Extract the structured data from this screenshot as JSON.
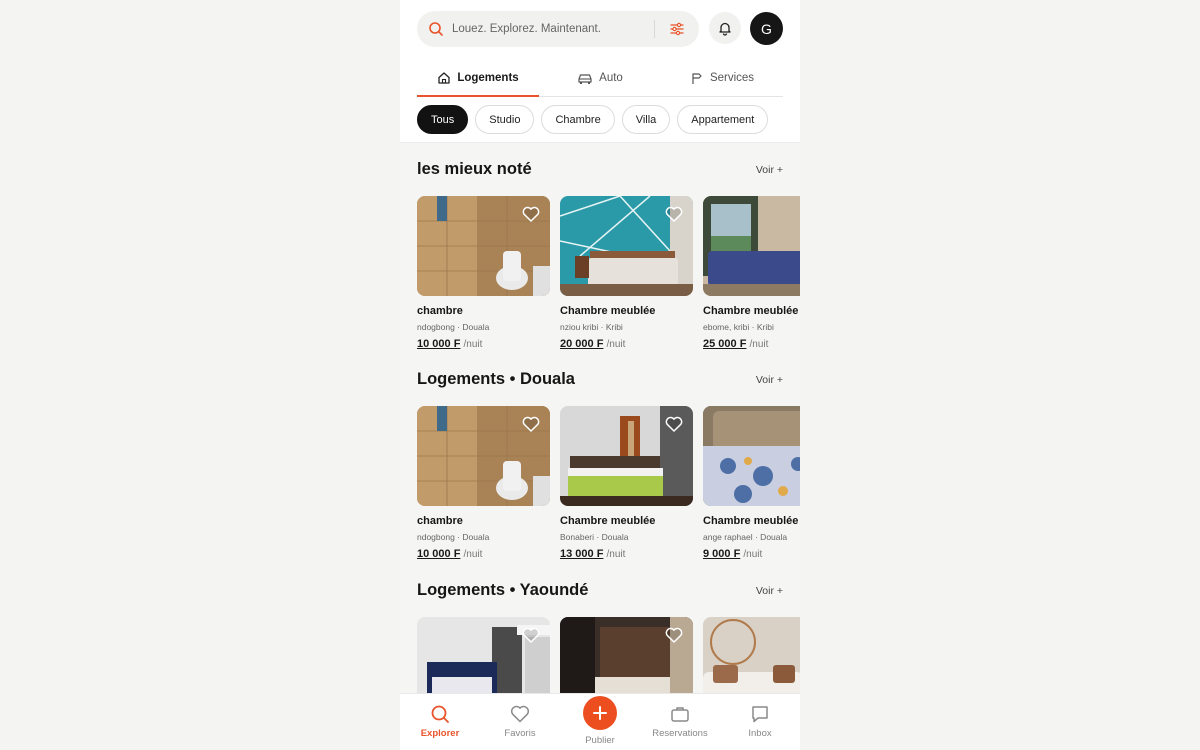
{
  "search": {
    "placeholder": "Louez. Explorez. Maintenant."
  },
  "avatar": {
    "initial": "G"
  },
  "tabs": [
    {
      "label": "Logements",
      "icon": "home-icon",
      "active": true
    },
    {
      "label": "Auto",
      "icon": "car-icon",
      "active": false
    },
    {
      "label": "Services",
      "icon": "services-icon",
      "active": false
    }
  ],
  "chips": [
    {
      "label": "Tous",
      "active": true
    },
    {
      "label": "Studio",
      "active": false
    },
    {
      "label": "Chambre",
      "active": false
    },
    {
      "label": "Villa",
      "active": false
    },
    {
      "label": "Appartement",
      "active": false
    }
  ],
  "sections": [
    {
      "title": "les mieux noté",
      "more": "Voir +",
      "cards": [
        {
          "title": "chambre",
          "location": "ndogbong · Douala",
          "price": "10 000 F",
          "unit": "/nuit",
          "image": "bathroom-photo"
        },
        {
          "title": "Chambre meublée",
          "location": "nziou kribi · Kribi",
          "price": "20 000 F",
          "unit": "/nuit",
          "image": "bedroom-teal-photo"
        },
        {
          "title": "Chambre meublée",
          "location": "ebome, kribi · Kribi",
          "price": "25 000 F",
          "unit": "/nuit",
          "image": "bedroom-window-photo"
        }
      ]
    },
    {
      "title": "Logements • Douala",
      "more": "Voir +",
      "cards": [
        {
          "title": "chambre",
          "location": "ndogbong · Douala",
          "price": "10 000 F",
          "unit": "/nuit",
          "image": "bathroom-photo"
        },
        {
          "title": "Chambre meublée",
          "location": "Bonaberi · Douala",
          "price": "13 000 F",
          "unit": "/nuit",
          "image": "bedroom-green-photo"
        },
        {
          "title": "Chambre meublée",
          "location": "ange raphael · Douala",
          "price": "9 000 F",
          "unit": "/nuit",
          "image": "bedroom-floral-photo"
        }
      ]
    },
    {
      "title": "Logements • Yaoundé",
      "more": "Voir +",
      "cards": [
        {
          "image": "bedroom-blue-photo"
        },
        {
          "image": "bedroom-dark-photo"
        },
        {
          "image": "living-room-photo"
        }
      ]
    }
  ],
  "nav": [
    {
      "label": "Explorer",
      "icon": "search-icon",
      "active": true
    },
    {
      "label": "Favoris",
      "icon": "heart-icon",
      "active": false
    },
    {
      "label": "Publier",
      "icon": "plus-icon",
      "active": false
    },
    {
      "label": "Reservations",
      "icon": "briefcase-icon",
      "active": false
    },
    {
      "label": "Inbox",
      "icon": "chat-icon",
      "active": false
    }
  ],
  "colors": {
    "accent": "#e8542b",
    "dark": "#121212"
  }
}
